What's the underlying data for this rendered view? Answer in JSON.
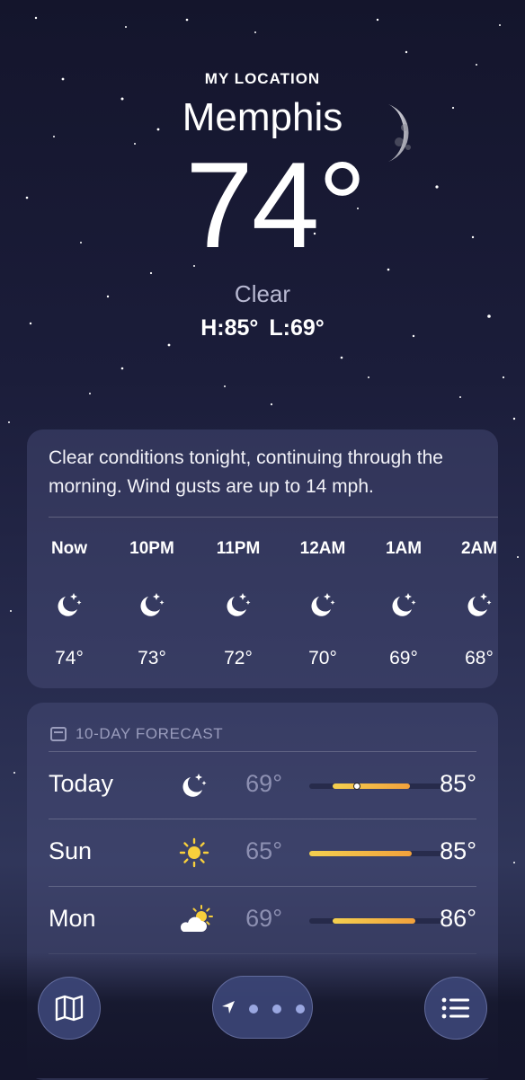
{
  "header": {
    "location_label": "MY LOCATION",
    "city": "Memphis",
    "temperature": "74°",
    "condition": "Clear",
    "high": "H:85°",
    "low": "L:69°"
  },
  "hourly": {
    "summary": "Clear conditions tonight, continuing through the morning. Wind gusts are up to 14 mph.",
    "hours": [
      {
        "time": "Now",
        "icon": "moon-stars-icon",
        "temp": "74°"
      },
      {
        "time": "10PM",
        "icon": "moon-stars-icon",
        "temp": "73°"
      },
      {
        "time": "11PM",
        "icon": "moon-stars-icon",
        "temp": "72°"
      },
      {
        "time": "12AM",
        "icon": "moon-stars-icon",
        "temp": "70°"
      },
      {
        "time": "1AM",
        "icon": "moon-stars-icon",
        "temp": "69°"
      },
      {
        "time": "2AM",
        "icon": "moon-stars-icon",
        "temp": "68°"
      }
    ]
  },
  "forecast": {
    "title": "10-DAY FORECAST",
    "days": [
      {
        "day": "Today",
        "icon": "moon-stars-icon",
        "low": "69°",
        "high": "85°",
        "current": "74°"
      },
      {
        "day": "Sun",
        "icon": "sun-icon",
        "low": "65°",
        "high": "85°"
      },
      {
        "day": "Mon",
        "icon": "partly-cloudy-icon",
        "low": "69°",
        "high": "86°"
      }
    ]
  },
  "colors": {
    "bar_start": "#f4d04f",
    "bar_end": "#f2a13c",
    "condition_text": "#b8b9d2"
  }
}
